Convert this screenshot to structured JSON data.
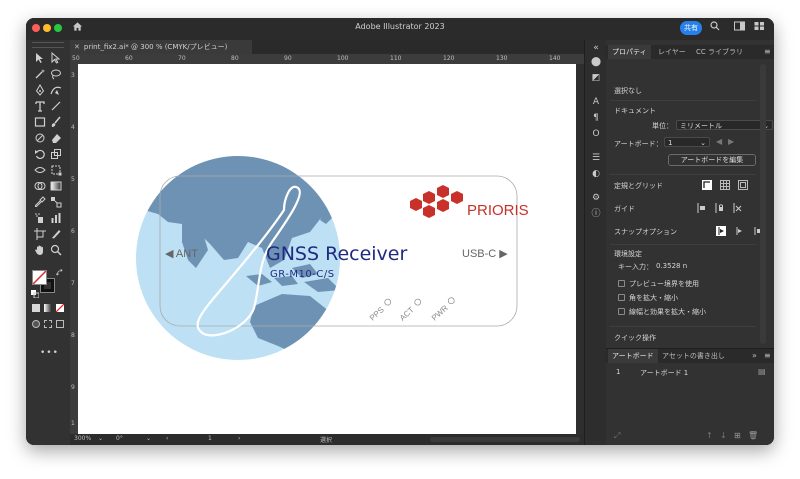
{
  "window": {
    "title": "Adobe Illustrator 2023",
    "share_label": "共有"
  },
  "document": {
    "tab_label": "print_fix2.ai* @ 300 % (CMYK/プレビュー)"
  },
  "rulers": {
    "top": [
      "50",
      "60",
      "70",
      "80",
      "90",
      "100",
      "110",
      "120",
      "130",
      "140",
      "150"
    ],
    "left": [
      "3",
      "4",
      "5",
      "6",
      "7",
      "8",
      "9",
      "1"
    ]
  },
  "artwork": {
    "brand_name": "PRIORIS",
    "product_title": "GNSS Receiver",
    "model": "GR-M10-C/S",
    "ant_label": "◀ ANT",
    "usb_label": "USB-C ▶",
    "led_pps": "PPS",
    "led_act": "ACT",
    "led_pwr": "PWR",
    "colors": {
      "brand_red": "#c8312a",
      "globe_fill": "#bde0f4",
      "land_fill": "#6d92b4",
      "title_blue": "#1f2a80",
      "outline_gray": "#aaaaaa"
    }
  },
  "statusbar": {
    "zoom": "300%",
    "rotation": "0°",
    "artboard_number": "1",
    "mode": "選択"
  },
  "panel": {
    "tabs": [
      "プロパティ",
      "レイヤー",
      "CC ライブラリ"
    ],
    "no_selection": "選択なし",
    "document_section": "ドキュメント",
    "unit_label": "単位：",
    "unit_value": "ミリメートル",
    "artboard_label": "アートボード：",
    "artboard_value": "1",
    "edit_artboard_button": "アートボードを編集",
    "rulers_grid_label": "定規とグリッド",
    "guides_label": "ガイド",
    "snap_label": "スナップオプション",
    "preferences_label": "環境設定",
    "key_increment_label": "キー入力：",
    "key_increment_value": "0.3528 n",
    "checkboxes": [
      "プレビュー境界を使用",
      "角を拡大・縮小",
      "線幅と効果を拡大・縮小"
    ],
    "quick_actions_label": "クイック操作",
    "bottom_tabs": [
      "アートボード",
      "アセットの書き出し"
    ],
    "artboard_list": [
      {
        "index": "1",
        "name": "アートボード 1"
      }
    ]
  }
}
